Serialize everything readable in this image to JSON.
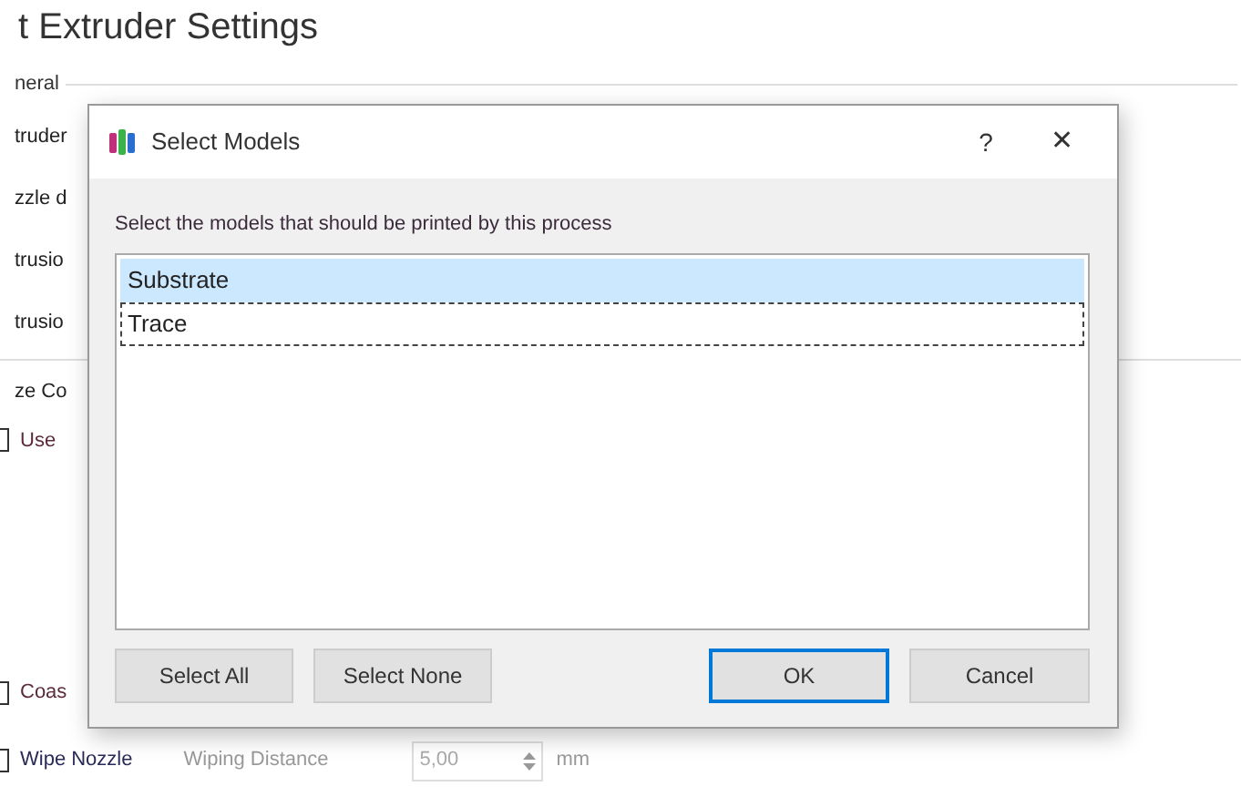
{
  "page": {
    "title": "t Extruder Settings"
  },
  "group_general": {
    "label": "neral",
    "fields": [
      "truder",
      "zzle d",
      "trusio",
      "trusio"
    ]
  },
  "group_2": {
    "label": "ze Co"
  },
  "options": [
    {
      "label": "Use",
      "checked": false
    },
    {
      "label": "Coas",
      "checked": false
    },
    {
      "label": "Wipe Nozzle",
      "checked": false,
      "setting_label": "Wiping Distance",
      "value": "5,00",
      "unit": "mm"
    }
  ],
  "dialog": {
    "title": "Select Models",
    "help": "?",
    "close": "✕",
    "instruction": "Select the models that should be printed by this process",
    "models": [
      {
        "name": "Substrate",
        "selected": true,
        "focused": false
      },
      {
        "name": "Trace",
        "selected": false,
        "focused": true
      }
    ],
    "left_buttons": [
      "Select All",
      "Select None"
    ],
    "right_buttons": [
      {
        "label": "OK",
        "default": true
      },
      {
        "label": "Cancel",
        "default": false
      }
    ]
  }
}
